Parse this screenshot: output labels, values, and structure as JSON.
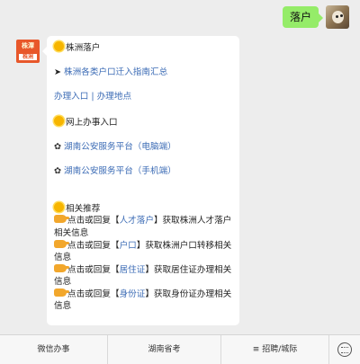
{
  "outgoing": {
    "text": "落户"
  },
  "bot_avatar": {
    "top": "株潭",
    "bottom": "株洲"
  },
  "message": {
    "title": "株洲落户",
    "guide_link": "株洲各类户口迁入指南汇总",
    "entry_link": "办理入口",
    "separator": " | ",
    "location_link": "办理地点",
    "online_title": "网上办事入口",
    "pc_link": "湖南公安服务平台（电脑端）",
    "mobile_link": "湖南公安服务平台（手机端）",
    "related_title": "相关推荐",
    "recommendations": [
      {
        "prefix": "点击或回复【",
        "keyword": "人才落户",
        "suffix": "】获取株洲人才落户相关信息"
      },
      {
        "prefix": "点击或回复【",
        "keyword": "户口",
        "suffix": "】获取株洲户口转移相关信息"
      },
      {
        "prefix": "点击或回复【",
        "keyword": "居住证",
        "suffix": "】获取居住证办理相关信息"
      },
      {
        "prefix": "点击或回复【",
        "keyword": "身份证",
        "suffix": "】获取身份证办理相关信息"
      }
    ]
  },
  "menu": {
    "item1": "微信办事",
    "item2": "湖南省考",
    "item3": "招聘/城际",
    "item3_icon": "≡"
  },
  "icons": {
    "sun": "sun-icon",
    "hand": "pointing-hand-icon",
    "flower": "flower-icon",
    "arrow": "arrow-icon",
    "keyboard": "keyboard-icon"
  }
}
